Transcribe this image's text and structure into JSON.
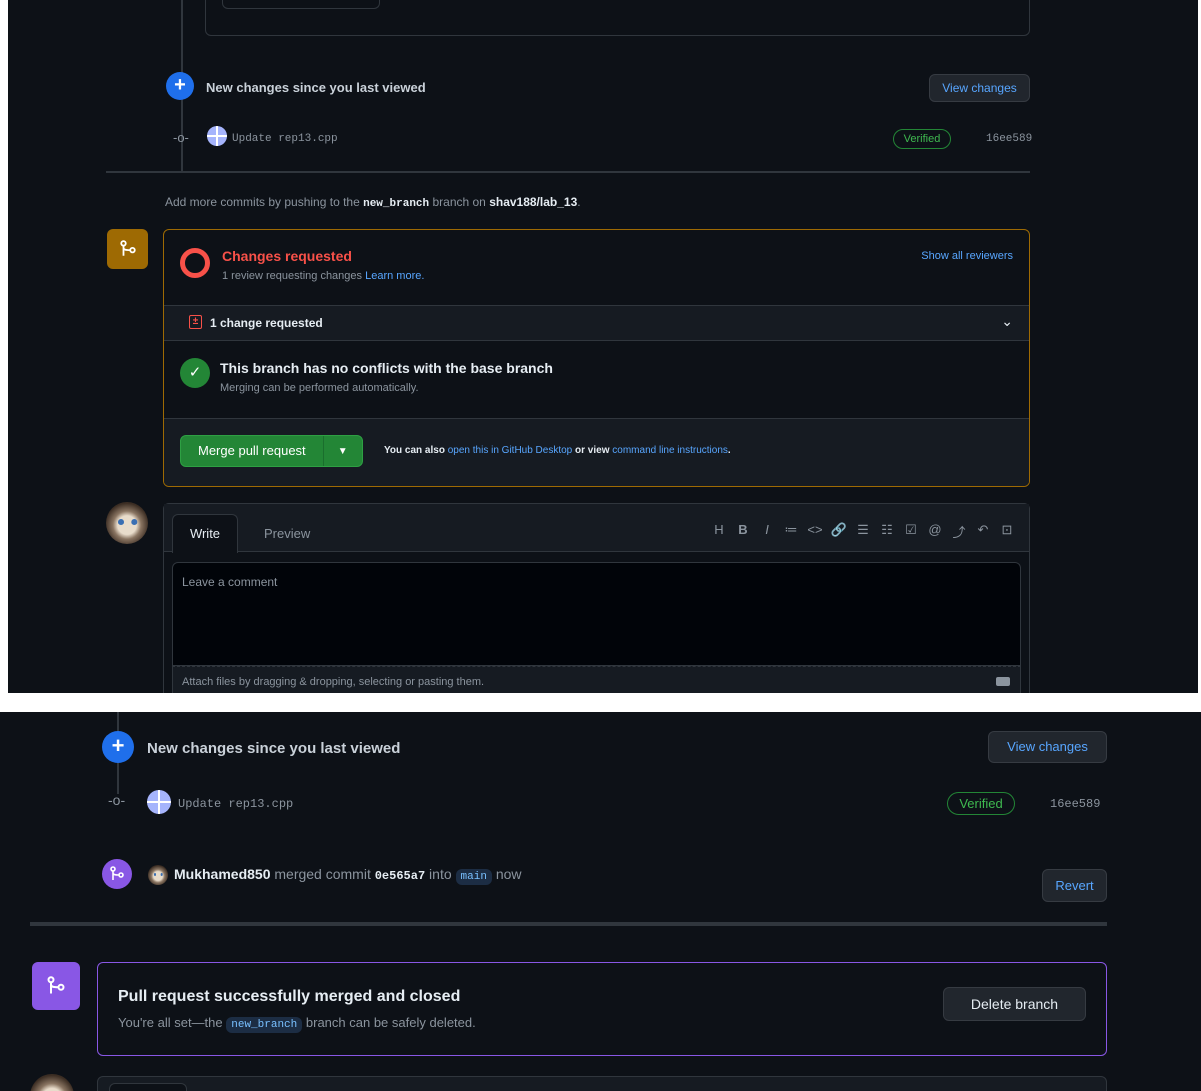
{
  "panel1": {
    "new_changes": "New changes since you last viewed",
    "view_changes": "View changes",
    "commit": {
      "message": "Update rep13.cpp",
      "verified": "Verified",
      "sha": "16ee589"
    },
    "add_more": {
      "prefix": "Add more commits by pushing to the",
      "branch": "new_branch",
      "middle": "branch on",
      "repo": "shav188/lab_13",
      "suffix": "."
    },
    "review": {
      "title": "Changes requested",
      "subtitle": "1 review requesting changes",
      "learn_more": "Learn more.",
      "show_all": "Show all reviewers",
      "changes_bar": "1 change requested",
      "conflicts_title": "This branch has no conflicts with the base branch",
      "conflicts_sub": "Merging can be performed automatically.",
      "merge_button": "Merge pull request",
      "also_prefix": "You can also",
      "open_desktop": "open this in GitHub Desktop",
      "or_view": "or view",
      "cli": "command line instructions",
      "also_suffix": "."
    },
    "comment": {
      "tab_write": "Write",
      "tab_preview": "Preview",
      "placeholder": "Leave a comment",
      "attach": "Attach files by dragging & dropping, selecting or pasting them.",
      "toolbar": [
        "H",
        "B",
        "I",
        "≔",
        "<>",
        "🔗",
        "☰",
        "☷",
        "☑",
        "@",
        "⤴",
        "↶",
        "⊡"
      ]
    }
  },
  "panel2": {
    "new_changes": "New changes since you last viewed",
    "view_changes": "View changes",
    "commit": {
      "message": "Update rep13.cpp",
      "verified": "Verified",
      "sha": "16ee589"
    },
    "merged_event": {
      "user": "Mukhamed850",
      "merged_commit": "merged commit",
      "sha": "0e565a7",
      "into": "into",
      "branch": "main",
      "time": "now",
      "revert": "Revert"
    },
    "merged_box": {
      "title": "Pull request successfully merged and closed",
      "sub_prefix": "You're all set—the",
      "branch": "new_branch",
      "sub_suffix": "branch can be safely deleted.",
      "delete_button": "Delete branch"
    }
  },
  "colors": {
    "background": "#0d1117",
    "accent_blue": "#1f6feb",
    "link": "#58a6ff",
    "danger": "#f85149",
    "success": "#238636",
    "merged_purple": "#8957e5",
    "warning_border": "#9e6a03"
  }
}
